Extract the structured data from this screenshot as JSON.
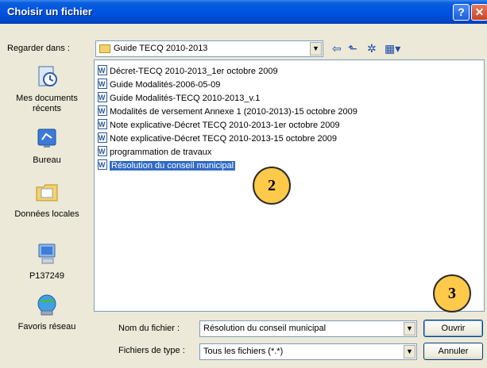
{
  "window": {
    "title": "Choisir un fichier",
    "help_glyph": "?",
    "close_glyph": "✕"
  },
  "lookin": {
    "label": "Regarder dans :",
    "folder": "Guide TECQ 2010-2013"
  },
  "toolbar": {
    "back_glyph": "⇦",
    "up_glyph": "⬑",
    "newfolder_glyph": "✲",
    "views_glyph": "▦▾"
  },
  "places": [
    {
      "label": "Mes documents récents"
    },
    {
      "label": "Bureau"
    },
    {
      "label": "Données locales"
    },
    {
      "label": "P137249"
    },
    {
      "label": "Favoris réseau"
    }
  ],
  "files": [
    {
      "name": "Décret-TECQ 2010-2013_1er octobre 2009"
    },
    {
      "name": "Guide Modalités-2006-05-09"
    },
    {
      "name": "Guide Modalités-TECQ 2010-2013_v.1"
    },
    {
      "name": "Modalités de versement Annexe 1 (2010-2013)-15 octobre 2009"
    },
    {
      "name": "Note explicative-Décret TECQ 2010-2013-1er octobre 2009"
    },
    {
      "name": "Note explicative-Décret TECQ 2010-2013-15 octobre 2009"
    },
    {
      "name": "programmation de travaux"
    },
    {
      "name": "Résolution du conseil municipal",
      "selected": true
    }
  ],
  "filename": {
    "label": "Nom du fichier :",
    "value": "Résolution du conseil municipal"
  },
  "filetype": {
    "label": "Fichiers de type :",
    "value": "Tous les fichiers (*.*)"
  },
  "buttons": {
    "open": "Ouvrir",
    "cancel": "Annuler"
  },
  "callouts": {
    "c2": "2",
    "c3": "3"
  },
  "colors": {
    "titlebar": "#0054e3",
    "selection": "#316ac5",
    "callout": "#ffc94a",
    "dialog_bg": "#ece9d8"
  }
}
